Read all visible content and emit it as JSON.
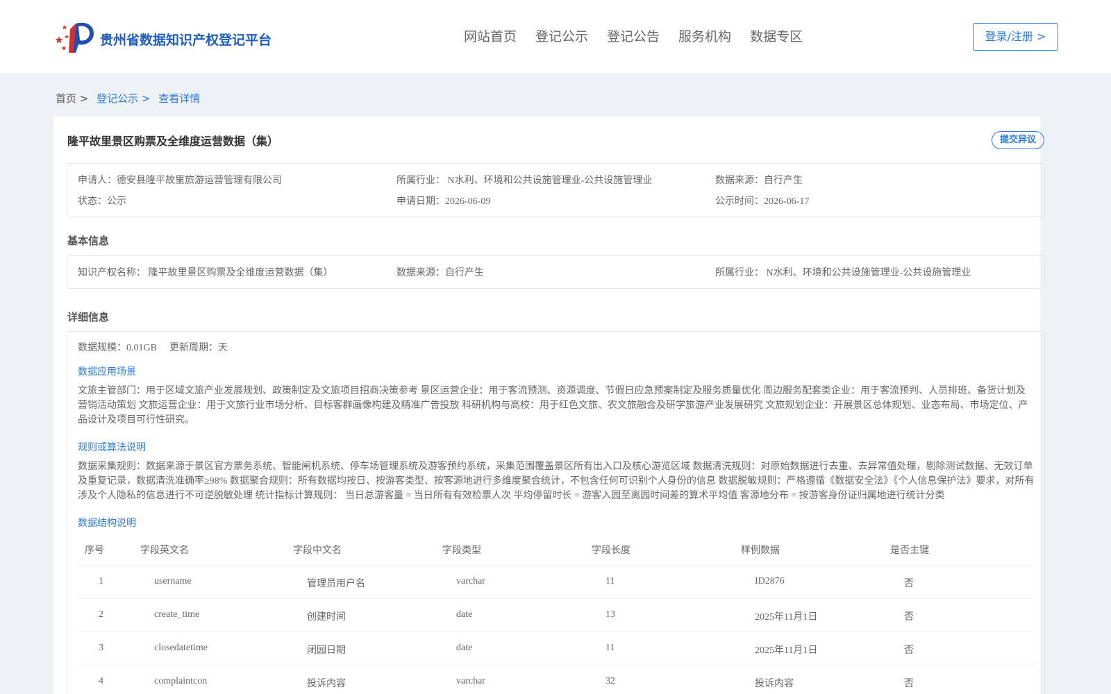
{
  "header": {
    "brand": "贵州省数据知识产权登记平台",
    "nav": [
      "网站首页",
      "登记公示",
      "登记公告",
      "服务机构",
      "数据专区"
    ],
    "login": "登录/注册 >"
  },
  "breadcrumb": {
    "home": "首页 >",
    "list": "登记公示 >",
    "current": "查看详情"
  },
  "title": "隆平故里景区购票及全维度运营数据（集）",
  "objection_button": "提交异议",
  "summary": {
    "applicant": "申请人：德安县隆平故里旅游运营管理有限公司",
    "industry": "所属行业： N水利、环境和公共设施管理业-公共设施管理业",
    "source": "数据来源：自行产生",
    "status": "状态：公示",
    "apply_date": "申请日期：2026-06-09",
    "publish_date": "公示时间：2026-06-17"
  },
  "basic": {
    "heading": "基本信息",
    "ip_name": "知识产权名称： 隆平故里景区购票及全维度运营数据（集）",
    "source": "数据来源：自行产生",
    "industry": "所属行业： N水利、环境和公共设施管理业-公共设施管理业"
  },
  "detail": {
    "heading": "详细信息",
    "scale": "数据规模：0.01GB",
    "period": "更新周期：天",
    "scenario_heading": "数据应用场景",
    "scenario_text": "文旅主管部门：用于区域文旅产业发展规划、政策制定及文旅项目招商决策参考 景区运营企业：用于客流预测、资源调度、节假日应急预案制定及服务质量优化 周边服务配套类企业：用于客流预判、人员排班、备货计划及营销活动策划 文旅运营企业：用于文旅行业市场分析、目标客群画像构建及精准广告投放 科研机构与高校：用于红色文旅、农文旅融合及研学旅游产业发展研究 文旅规划企业：开展景区总体规划、业态布局、市场定位、产品设计及项目可行性研究。",
    "rules_heading": "规则或算法说明",
    "rules_text": "数据采集规则：数据来源于景区官方票务系统、智能闸机系统、停车场管理系统及游客预约系统，采集范围覆盖景区所有出入口及核心游览区域 数据清洗规则：对原始数据进行去重、去异常值处理，剔除测试数据、无效订单及重复记录，数据清洗准确率≥98% 数据聚合规则：所有数据均按日、按游客类型、按客源地进行多维度聚合统计，不包含任何可识别个人身份的信息 数据脱敏规则：严格遵循《数据安全法》《个人信息保护法》要求，对所有涉及个人隐私的信息进行不可逆脱敏处理 统计指标计算规则： 当日总游客量 = 当日所有有效检票人次 平均停留时长 = 游客入园至离园时间差的算术平均值 客源地分布 = 按游客身份证归属地进行统计分类",
    "structure_heading": "数据结构说明"
  },
  "table": {
    "headers": [
      "序号",
      "字段英文名",
      "字段中文名",
      "字段类型",
      "字段长度",
      "样例数据",
      "是否主键"
    ],
    "rows": [
      [
        "1",
        "username",
        "管理员用户名",
        "varchar",
        "11",
        "ID2876",
        "否"
      ],
      [
        "2",
        "create_time",
        "创建时间",
        "date",
        "13",
        "2025年11月1日",
        "否"
      ],
      [
        "3",
        "closedatetime",
        "闭园日期",
        "date",
        "11",
        "2025年11月1日",
        "否"
      ],
      [
        "4",
        "complaintcon",
        "投诉内容",
        "varchar",
        "32",
        "投诉内容",
        "否"
      ]
    ]
  },
  "colors": {
    "accent": "#2a7be4",
    "brand": "#1f5fc0",
    "background": "#eef2f6"
  },
  "icons": {
    "logo": "flag-logo-icon"
  }
}
